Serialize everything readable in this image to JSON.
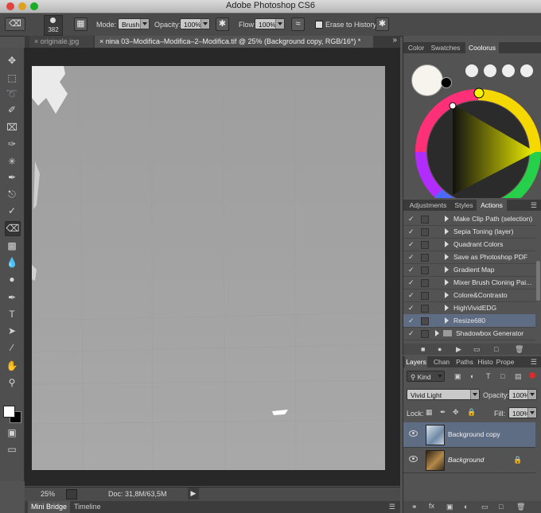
{
  "window": {
    "title": "Adobe Photoshop CS6"
  },
  "options": {
    "brush_size": "382",
    "mode_label": "Mode:",
    "mode_value": "Brush",
    "opacity_label": "Opacity:",
    "opacity_value": "100%",
    "flow_label": "Flow:",
    "flow_value": "100%",
    "erase_history_label": "Erase to History"
  },
  "tabs": [
    {
      "label": "originale.jpg"
    },
    {
      "label": "nina 03–Modifica–Modifica–2–Modifica.tif @ 25% (Background copy, RGB/16*) *"
    }
  ],
  "status": {
    "zoom": "25%",
    "doc": "Doc: 31,8M/63,5M"
  },
  "bottom_tabs": [
    {
      "label": "Mini Bridge"
    },
    {
      "label": "Timeline"
    }
  ],
  "color_panel": {
    "tabs": [
      "Color",
      "Swatches",
      "Coolorus"
    ]
  },
  "actions_panel": {
    "tabs": [
      "Adjustments",
      "Styles",
      "Actions"
    ],
    "items": [
      {
        "label": "Make Clip Path (selection)"
      },
      {
        "label": "Sepia Toning (layer)"
      },
      {
        "label": "Quadrant Colors"
      },
      {
        "label": "Save as Photoshop PDF"
      },
      {
        "label": "Gradient Map"
      },
      {
        "label": "Mixer Brush Cloning Pai..."
      },
      {
        "label": "Colore&Contrasto"
      },
      {
        "label": "HighVividEDG"
      },
      {
        "label": "Resize680"
      },
      {
        "label": "Shadowbox Generator"
      }
    ]
  },
  "layers_panel": {
    "tabs": [
      "Layers",
      "Chan",
      "Paths",
      "Histo",
      "Prope"
    ],
    "kind_label": "Kind",
    "blend_mode": "Vivid Light",
    "opacity_label": "Opacity:",
    "opacity_value": "100%",
    "lock_label": "Lock:",
    "fill_label": "Fill:",
    "fill_value": "100%",
    "layers": [
      {
        "name": "Background copy"
      },
      {
        "name": "Background"
      }
    ]
  },
  "colors": {
    "accent_selection": "#5e6c84",
    "canvas_gray": "#a4a4a4"
  }
}
